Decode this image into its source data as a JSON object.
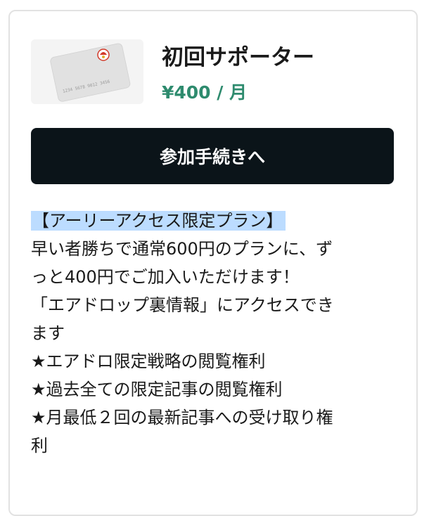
{
  "plan": {
    "title": "初回サポーター",
    "price": "¥400 / 月",
    "card_number": "1234 5678 9012 3456",
    "accent_color": "#2e8b6e"
  },
  "cta": {
    "label": "参加手続きへ",
    "background": "#0b1419"
  },
  "description": {
    "heading": "【アーリーアクセス限定プラン】",
    "lines": [
      "早い者勝ちで通常600円のプランに、ず",
      "っと400円でご加入いただけます！",
      "「エアドロップ裏情報」にアクセスでき",
      "ます",
      "★エアドロ限定戦略の閲覧権利",
      "★過去全ての限定記事の閲覧権利",
      "★月最低２回の最新記事への受け取り権",
      "利"
    ],
    "highlight_color": "#bcdcff"
  }
}
